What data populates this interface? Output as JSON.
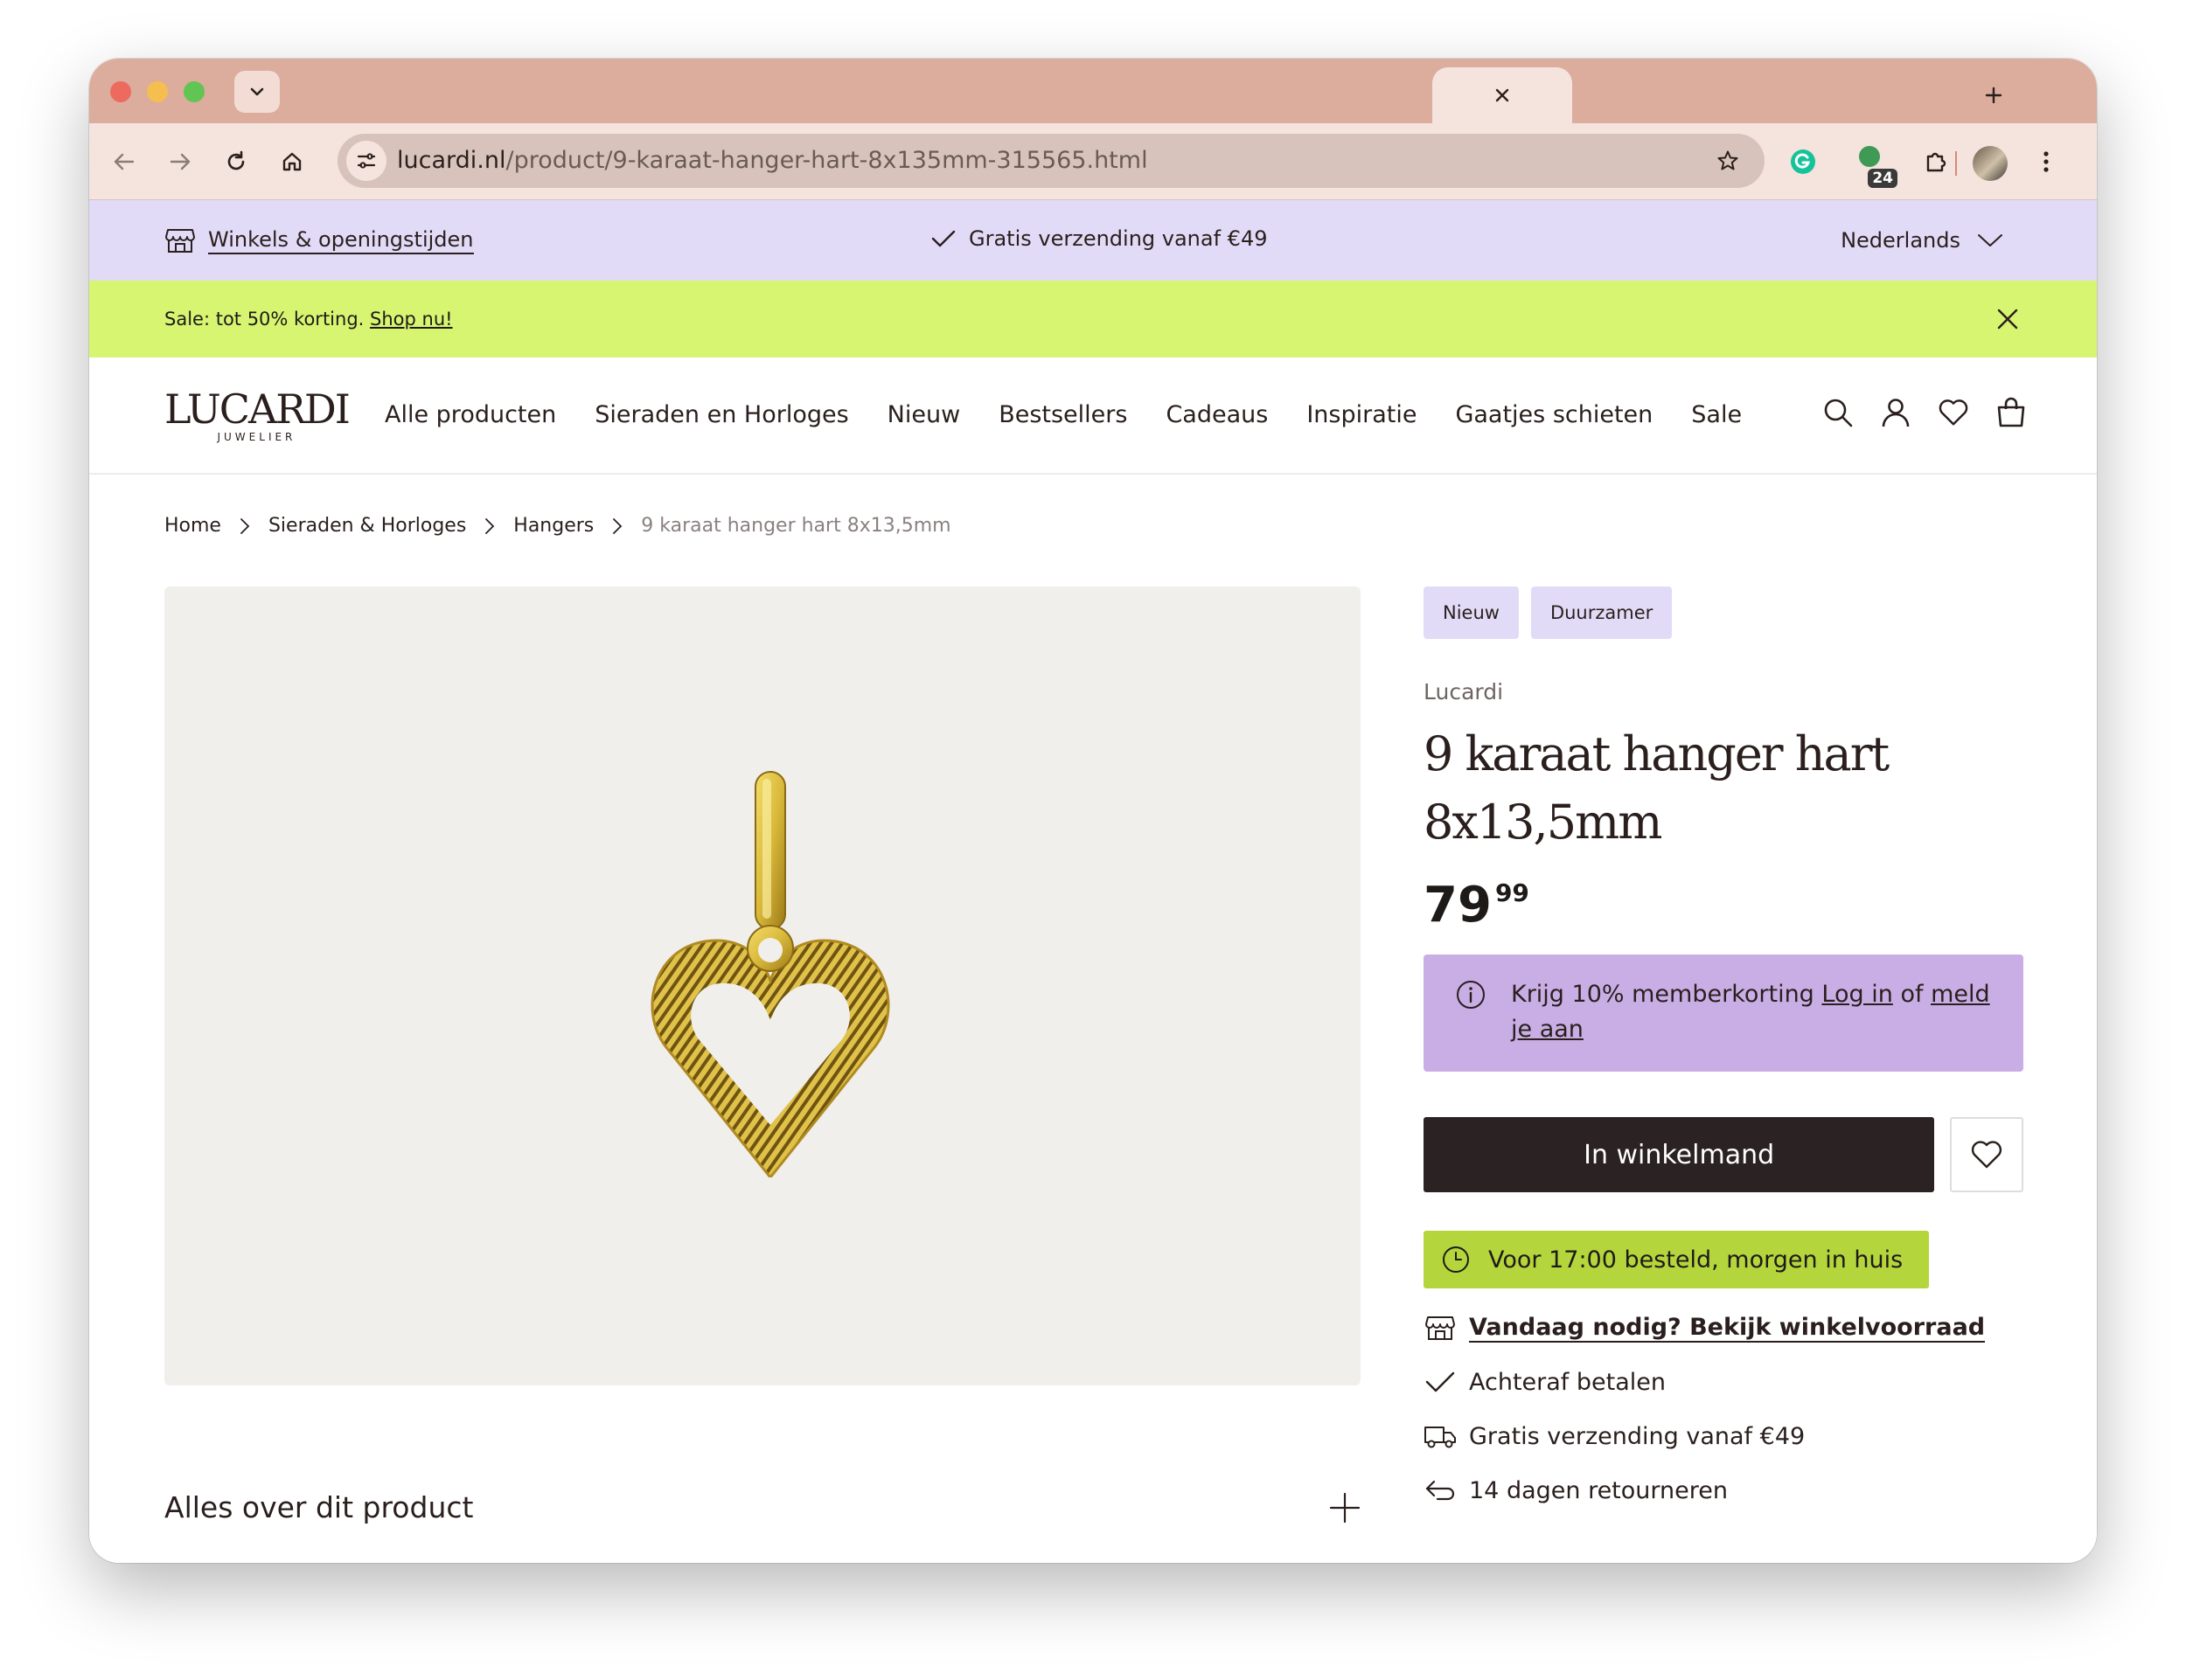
{
  "browser": {
    "url_host": "lucardi.nl",
    "url_path": "/product/9-karaat-hanger-hart-8x135mm-315565.html",
    "extension_badge": "24"
  },
  "topbar": {
    "stores_label": "Winkels & openingstijden",
    "shipping_label": "Gratis verzending vanaf €49",
    "language_label": "Nederlands"
  },
  "salebar": {
    "text": "Sale: tot 50% korting.",
    "link": "Shop nu!"
  },
  "nav": {
    "logo": "LUCARDI",
    "logo_sub": "JUWELIER",
    "items": [
      "Alle producten",
      "Sieraden en Horloges",
      "Nieuw",
      "Bestsellers",
      "Cadeaus",
      "Inspiratie",
      "Gaatjes schieten",
      "Sale"
    ]
  },
  "breadcrumbs": [
    "Home",
    "Sieraden & Horloges",
    "Hangers",
    "9 karaat hanger hart 8x13,5mm"
  ],
  "product": {
    "badges": [
      "Nieuw",
      "Duurzamer"
    ],
    "brand": "Lucardi",
    "title_line1": "9 karaat hanger hart",
    "title_line2": "8x13,5mm",
    "price_int": "79",
    "price_dec": "99",
    "member_text": "Krijg 10% memberkorting",
    "member_login": "Log in",
    "member_or": "of",
    "member_signup": "meld je aan",
    "add_to_cart": "In winkelmand",
    "delivery": "Voor 17:00 besteld, morgen in huis",
    "usps": [
      "Vandaag nodig? Bekijk winkelvoorraad",
      "Achteraf betalen",
      "Gratis verzending vanaf €49",
      "14 dagen retourneren"
    ]
  },
  "about": {
    "label": "Alles over dit product"
  },
  "colors": {
    "topbar": "#e2dbf7",
    "salebar": "#d8f571",
    "button": "#2b2224",
    "member": "#c9aee6",
    "delivery": "#b5d53d",
    "gold": "#d9b93a"
  }
}
